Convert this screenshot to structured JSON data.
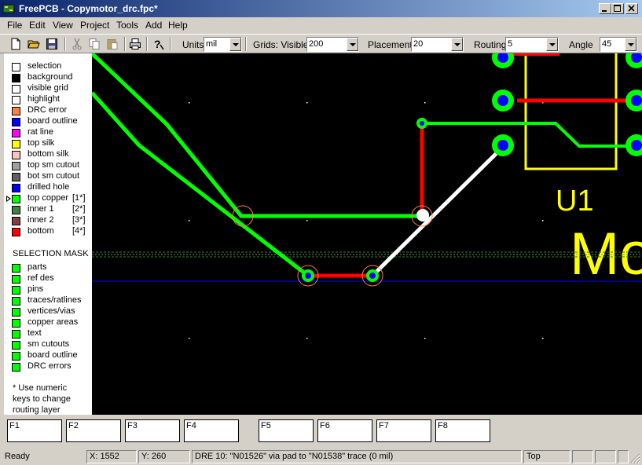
{
  "window": {
    "title": "FreePCB - Copymotor_drc.fpc*"
  },
  "menu": [
    "File",
    "Edit",
    "View",
    "Project",
    "Tools",
    "Add",
    "Help"
  ],
  "toolbar": {
    "units_label": "Units",
    "units_value": "mil",
    "grids_label": "Grids: Visible",
    "grids_value": "200",
    "placement_label": "Placement",
    "placement_value": "20",
    "routing_label": "Routing",
    "routing_value": "5",
    "angle_label": "Angle",
    "angle_value": "45"
  },
  "layers": [
    {
      "name": "selection",
      "color": "#ffffff",
      "num": ""
    },
    {
      "name": "background",
      "color": "#000000",
      "num": ""
    },
    {
      "name": "visible grid",
      "color": "#ffffff",
      "num": ""
    },
    {
      "name": "highlight",
      "color": "#ffffff",
      "num": ""
    },
    {
      "name": "DRC error",
      "color": "#ff8040",
      "num": ""
    },
    {
      "name": "board outline",
      "color": "#0000ff",
      "num": ""
    },
    {
      "name": "rat line",
      "color": "#ff00ff",
      "num": ""
    },
    {
      "name": "top silk",
      "color": "#ffff00",
      "num": ""
    },
    {
      "name": "bottom silk",
      "color": "#ffc0c0",
      "num": ""
    },
    {
      "name": "top sm cutout",
      "color": "#a0a0a0",
      "num": ""
    },
    {
      "name": "bot sm cutout",
      "color": "#606060",
      "num": ""
    },
    {
      "name": "drilled hole",
      "color": "#0000ff",
      "num": ""
    },
    {
      "name": "top copper",
      "color": "#00ff00",
      "num": "[1*]"
    },
    {
      "name": "inner 1",
      "color": "#408040",
      "num": "[2*]"
    },
    {
      "name": "inner 2",
      "color": "#804040",
      "num": "[3*]"
    },
    {
      "name": "bottom",
      "color": "#ff0000",
      "num": "[4*]"
    }
  ],
  "selection_mask": {
    "title": "SELECTION MASK",
    "items": [
      "parts",
      "ref des",
      "pins",
      "traces/ratlines",
      "vertices/vias",
      "copper areas",
      "text",
      "sm cutouts",
      "board outline",
      "DRC errors"
    ],
    "color": "#00ff00"
  },
  "note": [
    "* Use numeric",
    "keys to change",
    "routing layer"
  ],
  "canvas": {
    "refdes": "U1",
    "value_text": "Mo"
  },
  "fkeys": [
    "F1",
    "F2",
    "F3",
    "F4",
    "F5",
    "F6",
    "F7",
    "F8"
  ],
  "status": {
    "ready": "Ready",
    "x": "X: 1552",
    "y": "Y: 260",
    "message": "DRE 10: \"N01526\" via pad to \"N01538\" trace (0 mil)",
    "layer": "Top"
  }
}
